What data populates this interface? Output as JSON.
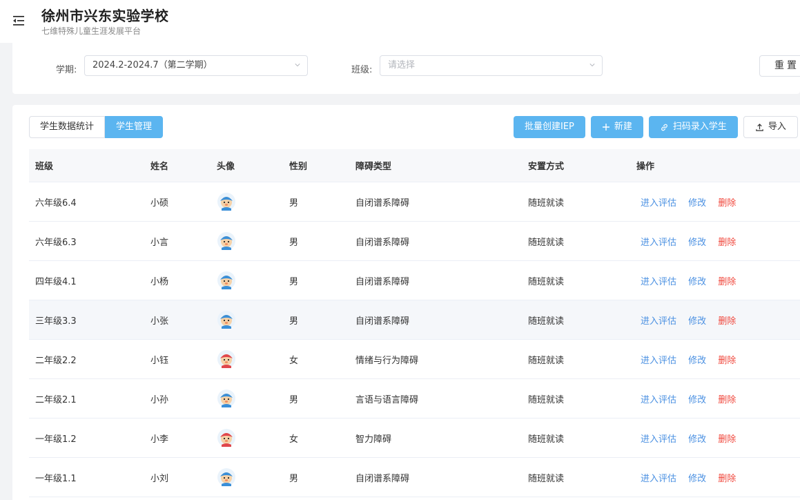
{
  "header": {
    "title": "徐州市兴东实验学校",
    "subtitle": "七维特殊儿童生涯发展平台"
  },
  "filters": {
    "term_label": "学期:",
    "term_value": "2024.2-2024.7（第二学期）",
    "class_label": "班级:",
    "class_placeholder": "请选择",
    "reset_label": "重置"
  },
  "tabs": [
    {
      "label": "学生数据统计",
      "active": false
    },
    {
      "label": "学生管理",
      "active": true
    }
  ],
  "actions": {
    "batch_iep": "批量创建IEP",
    "new": "新建",
    "scan": "扫码录入学生",
    "import": "导入"
  },
  "table": {
    "columns": [
      "班级",
      "姓名",
      "头像",
      "性别",
      "障碍类型",
      "安置方式",
      "操作"
    ],
    "ops": {
      "assess": "进入评估",
      "edit": "修改",
      "delete": "删除"
    },
    "rows": [
      {
        "class": "六年级6.4",
        "name": "小硕",
        "avatar": "boy-avatar",
        "gender": "男",
        "disability": "自闭谱系障碍",
        "placement": "随班就读"
      },
      {
        "class": "六年级6.3",
        "name": "小言",
        "avatar": "boy-avatar",
        "gender": "男",
        "disability": "自闭谱系障碍",
        "placement": "随班就读"
      },
      {
        "class": "四年级4.1",
        "name": "小杨",
        "avatar": "boy-avatar",
        "gender": "男",
        "disability": "自闭谱系障碍",
        "placement": "随班就读"
      },
      {
        "class": "三年级3.3",
        "name": "小张",
        "avatar": "boy-avatar",
        "gender": "男",
        "disability": "自闭谱系障碍",
        "placement": "随班就读"
      },
      {
        "class": "二年级2.2",
        "name": "小钰",
        "avatar": "girl-avatar",
        "gender": "女",
        "disability": "情绪与行为障碍",
        "placement": "随班就读"
      },
      {
        "class": "二年级2.1",
        "name": "小孙",
        "avatar": "boy-avatar",
        "gender": "男",
        "disability": "言语与语言障碍",
        "placement": "随班就读"
      },
      {
        "class": "一年级1.2",
        "name": "小李",
        "avatar": "girl-avatar",
        "gender": "女",
        "disability": "智力障碍",
        "placement": "随班就读"
      },
      {
        "class": "一年级1.1",
        "name": "小刘",
        "avatar": "boy-avatar",
        "gender": "男",
        "disability": "自闭谱系障碍",
        "placement": "随班就读"
      }
    ]
  },
  "colors": {
    "primary": "#5bb5f0",
    "link": "#4a90e2",
    "danger": "#f0473c",
    "boy_avatar": "#3a8fd8",
    "girl_avatar": "#e0474c"
  }
}
